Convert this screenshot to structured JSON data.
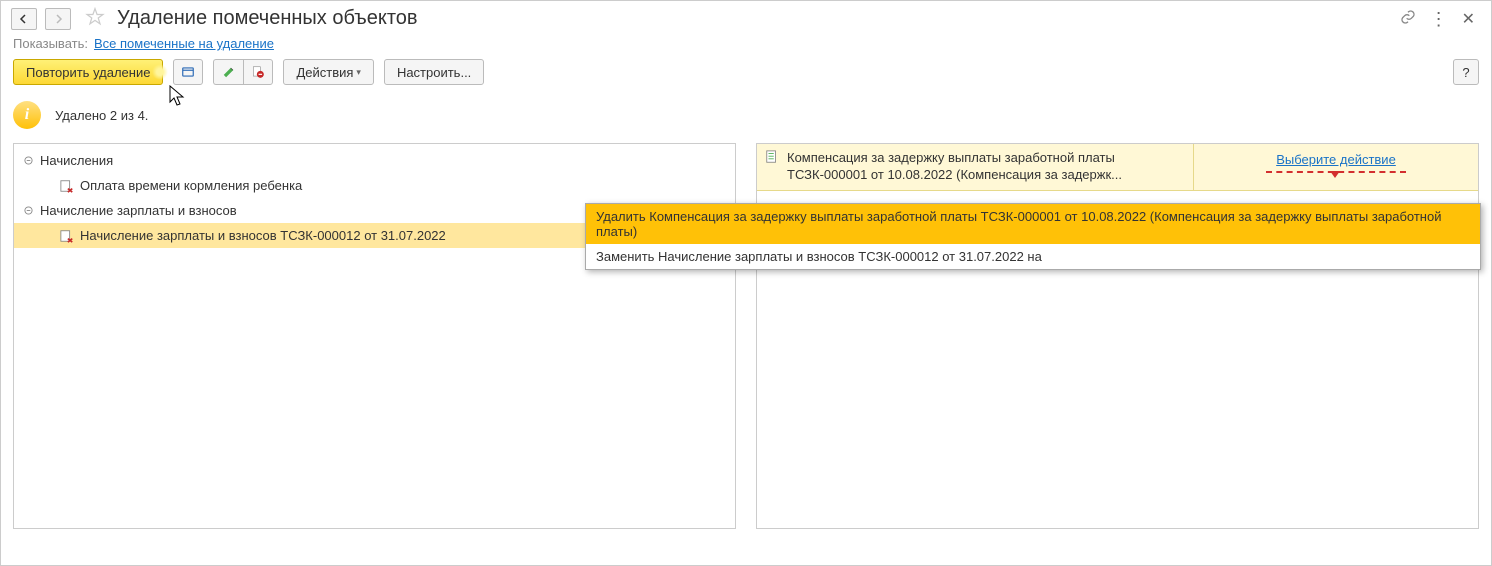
{
  "header": {
    "title": "Удаление помеченных объектов"
  },
  "filter": {
    "label": "Показывать:",
    "link": "Все помеченные на удаление"
  },
  "toolbar": {
    "repeat_delete": "Повторить удаление",
    "actions": "Действия",
    "settings": "Настроить...",
    "help": "?"
  },
  "status": {
    "info_letter": "i",
    "text": "Удалено 2 из 4."
  },
  "tree": {
    "group1": "Начисления",
    "item1": "Оплата времени кормления ребенка",
    "group2": "Начисление зарплаты и взносов",
    "item2": "Начисление зарплаты и взносов ТСЗК-000012 от 31.07.2022"
  },
  "right": {
    "compensation_line1": "Компенсация за задержку выплаты заработной платы",
    "compensation_line2": "ТСЗК-000001 от 10.08.2022 (Компенсация за задержк...",
    "action_link": "Выберите действие"
  },
  "menu": {
    "item1": "Удалить Компенсация за задержку выплаты заработной платы ТСЗК-000001 от 10.08.2022 (Компенсация за задержку выплаты заработной платы)",
    "item2": "Заменить Начисление зарплаты и взносов ТСЗК-000012 от 31.07.2022 на"
  }
}
